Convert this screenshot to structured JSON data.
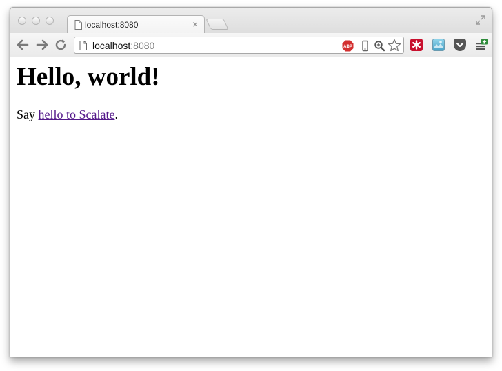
{
  "window": {
    "tab": {
      "title": "localhost:8080",
      "close_glyph": "×",
      "icon": "page-icon"
    },
    "controls": [
      "close",
      "minimize",
      "zoom"
    ]
  },
  "toolbar": {
    "url_host": "localhost",
    "url_port": ":8080",
    "omnibox_icons": [
      "adblock-icon",
      "mobile-icon",
      "zoom-icon",
      "bookmark-star-icon"
    ],
    "extensions": [
      "lastpass-icon",
      "image-extension-icon",
      "pocket-icon",
      "menu-icon"
    ],
    "colors": {
      "adblock": "#d32f2f",
      "lastpass": "#c8102e",
      "pocket": "#555555",
      "menu_badge": "#2e8b3a"
    }
  },
  "page": {
    "heading": "Hello, world!",
    "para_prefix": "Say ",
    "link_text": "hello to Scalate",
    "para_suffix": ".",
    "link_color": "#551a8b"
  }
}
